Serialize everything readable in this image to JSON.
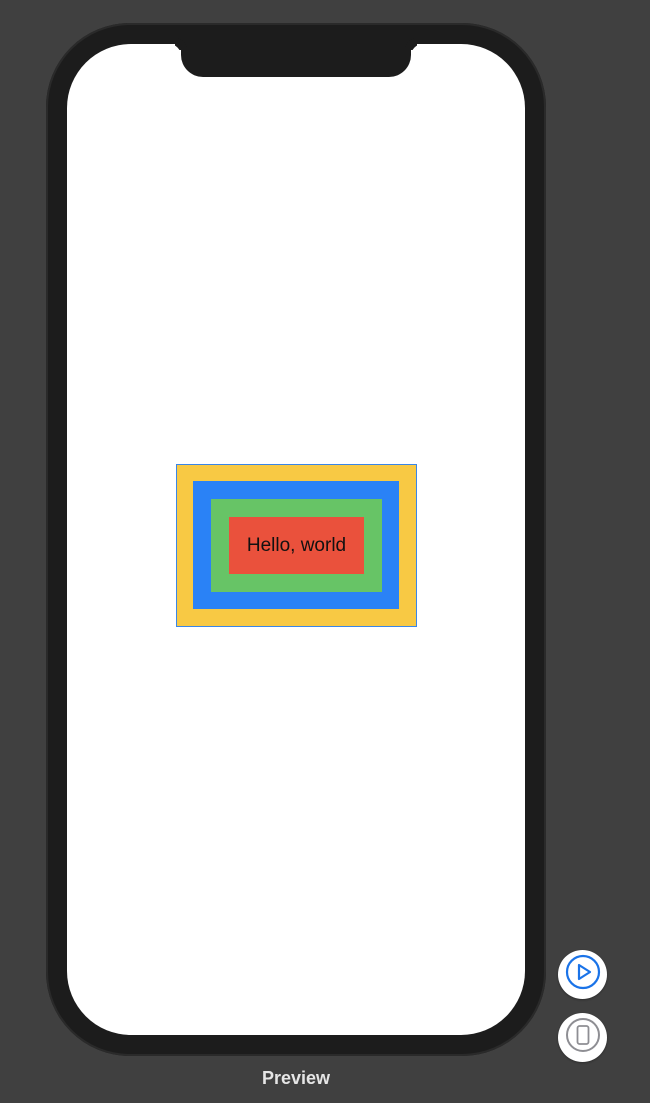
{
  "canvas": {
    "text": "Hello, world"
  },
  "controls": {
    "play_icon": "play-icon",
    "device_icon": "device-icon"
  },
  "footer": {
    "label": "Preview"
  },
  "colors": {
    "background": "#404040",
    "device_frame": "#1c1c1c",
    "screen": "#ffffff",
    "yellow": "#f8c944",
    "blue": "#2a82f6",
    "green": "#67c466",
    "red": "#ea513c",
    "selection_outline": "#3a86e8",
    "play_accent": "#1a73e8",
    "device_icon_gray": "#8e8e93"
  }
}
